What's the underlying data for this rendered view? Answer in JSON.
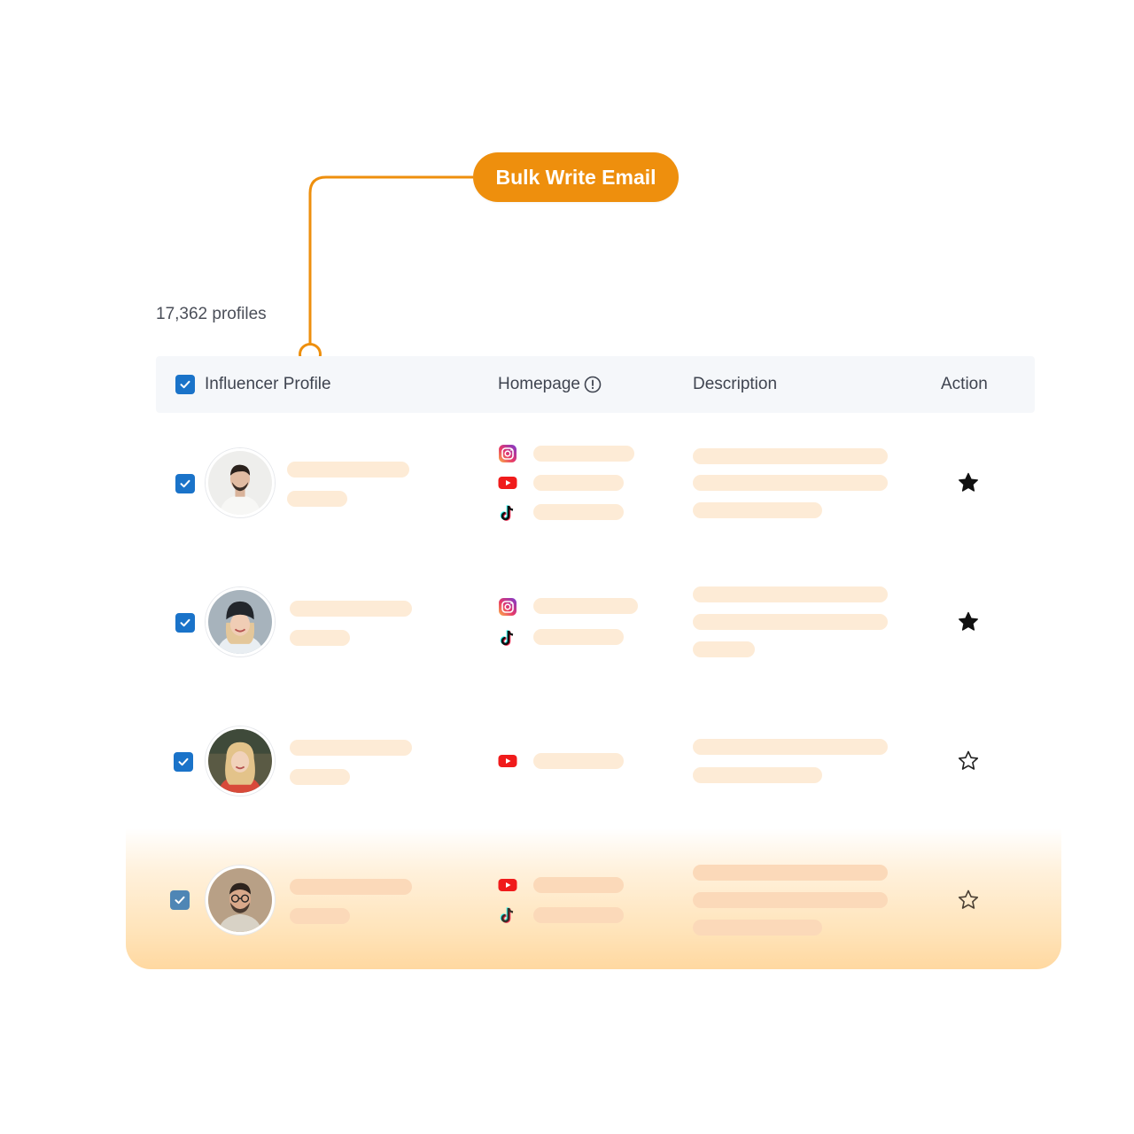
{
  "callout": {
    "button_label": "Bulk Write Email",
    "color": "#ee8f0d"
  },
  "profiles_count": "17,362 profiles",
  "table": {
    "columns": [
      "Influencer Profile",
      "Homepage",
      "Description",
      "Action"
    ],
    "homepage_info_icon": "info-circle-icon",
    "header_checked": true,
    "rows": [
      {
        "checked": true,
        "avatar": "man-short-hair",
        "platforms": [
          "instagram",
          "youtube",
          "tiktok"
        ],
        "starred": true
      },
      {
        "checked": true,
        "avatar": "woman-beanie",
        "platforms": [
          "instagram",
          "tiktok"
        ],
        "starred": true
      },
      {
        "checked": true,
        "avatar": "woman-blonde",
        "platforms": [
          "youtube"
        ],
        "starred": false
      },
      {
        "checked": true,
        "avatar": "man-glasses-beard",
        "platforms": [
          "youtube",
          "tiktok"
        ],
        "starred": false
      }
    ]
  },
  "colors": {
    "accent": "#ee8f0d",
    "checkbox": "#1a73c9",
    "placeholder_bar": "#fdebd6",
    "header_bg": "#f5f7fa"
  }
}
